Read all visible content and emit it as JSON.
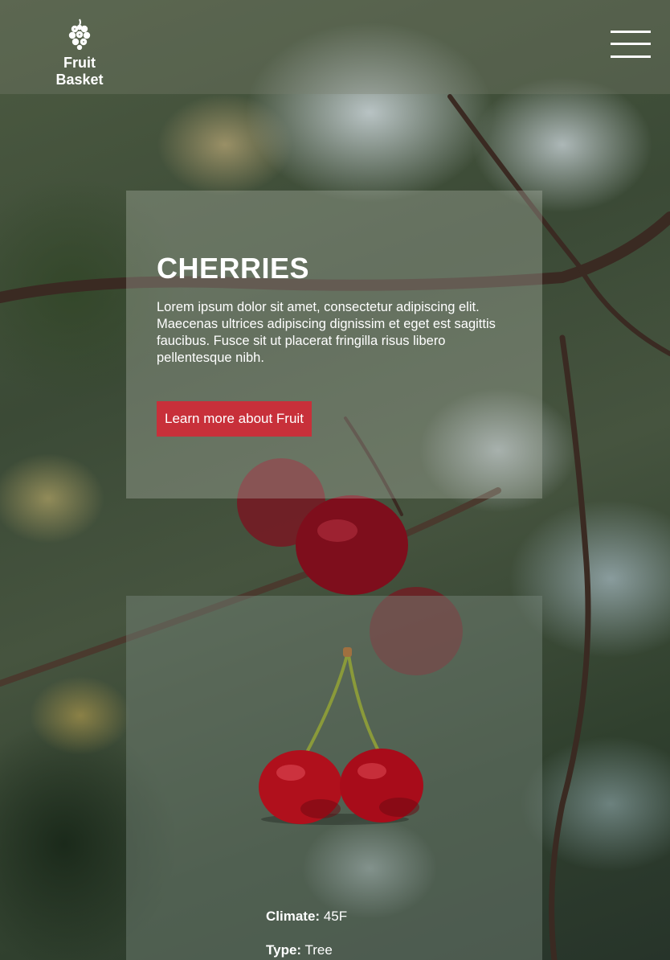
{
  "header": {
    "logo_icon": "grape-icon",
    "brand_name": "Fruit Basket",
    "menu_icon": "hamburger-menu-icon"
  },
  "hero": {
    "title": "CHERRIES",
    "body": "Lorem ipsum dolor sit amet, consectetur adipiscing elit. Maecenas ultrices adipiscing dignissim et eget est sagittis faucibus. Fusce sit ut placerat fringilla risus libero pellentesque nibh.",
    "cta_label": "Learn more about Fruit",
    "cta_color": "#c8303a"
  },
  "details": {
    "image_icon": "cherries-image",
    "climate_label": "Climate:",
    "climate_value": "45F",
    "type_label": "Type:",
    "type_value": "Tree"
  }
}
